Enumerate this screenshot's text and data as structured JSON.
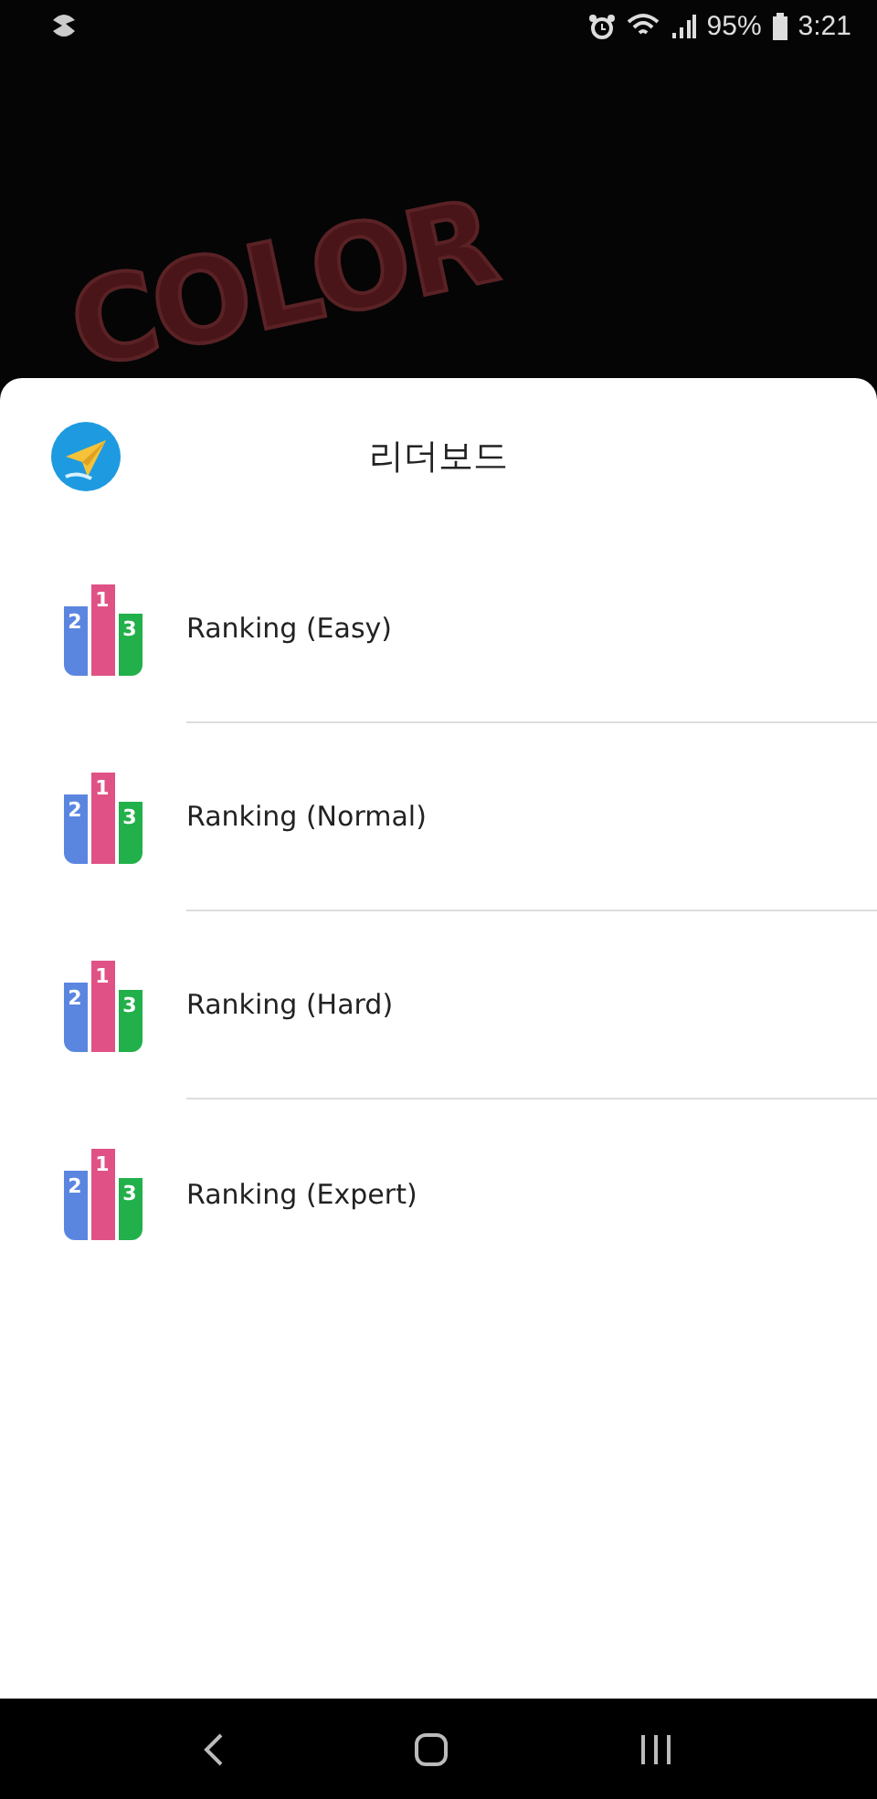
{
  "status_bar": {
    "battery_text": "95%",
    "time": "3:21"
  },
  "background_logo": "COLOR",
  "sheet": {
    "title": "리더보드",
    "items": [
      {
        "label": "Ranking (Easy)",
        "ranks": [
          "2",
          "1",
          "3"
        ]
      },
      {
        "label": "Ranking (Normal)",
        "ranks": [
          "2",
          "1",
          "3"
        ]
      },
      {
        "label": "Ranking (Hard)",
        "ranks": [
          "2",
          "1",
          "3"
        ]
      },
      {
        "label": "Ranking (Expert)",
        "ranks": [
          "2",
          "1",
          "3"
        ]
      }
    ]
  }
}
